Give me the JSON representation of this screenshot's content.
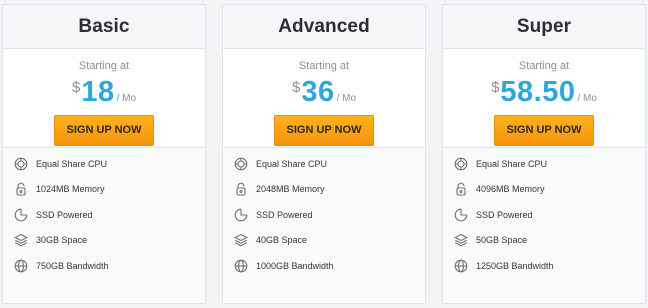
{
  "plans": [
    {
      "name": "Basic",
      "starting_label": "Starting at",
      "currency": "$",
      "price": "18",
      "period": "/ Mo",
      "cta": "SIGN UP NOW",
      "features": [
        {
          "icon": "cpu-icon",
          "label": "Equal Share CPU"
        },
        {
          "icon": "memory-icon",
          "label": "1024MB Memory"
        },
        {
          "icon": "ssd-icon",
          "label": "SSD Powered"
        },
        {
          "icon": "storage-layers-icon",
          "label": "30GB Space"
        },
        {
          "icon": "globe-icon",
          "label": "750GB Bandwidth"
        }
      ]
    },
    {
      "name": "Advanced",
      "starting_label": "Starting at",
      "currency": "$",
      "price": "36",
      "period": "/ Mo",
      "cta": "SIGN UP NOW",
      "features": [
        {
          "icon": "cpu-icon",
          "label": "Equal Share CPU"
        },
        {
          "icon": "memory-icon",
          "label": "2048MB Memory"
        },
        {
          "icon": "ssd-icon",
          "label": "SSD Powered"
        },
        {
          "icon": "storage-layers-icon",
          "label": "40GB Space"
        },
        {
          "icon": "globe-icon",
          "label": "1000GB Bandwidth"
        }
      ]
    },
    {
      "name": "Super",
      "starting_label": "Starting at",
      "currency": "$",
      "price": "58.50",
      "period": "/ Mo",
      "cta": "SIGN UP NOW",
      "features": [
        {
          "icon": "cpu-icon",
          "label": "Equal Share CPU"
        },
        {
          "icon": "memory-icon",
          "label": "4096MB Memory"
        },
        {
          "icon": "ssd-icon",
          "label": "SSD Powered"
        },
        {
          "icon": "storage-layers-icon",
          "label": "50GB Space"
        },
        {
          "icon": "globe-icon",
          "label": "1250GB Bandwidth"
        }
      ]
    }
  ],
  "colors": {
    "price": "#2ea7dc",
    "button": "#f9a015",
    "background": "#f1f3f4"
  }
}
